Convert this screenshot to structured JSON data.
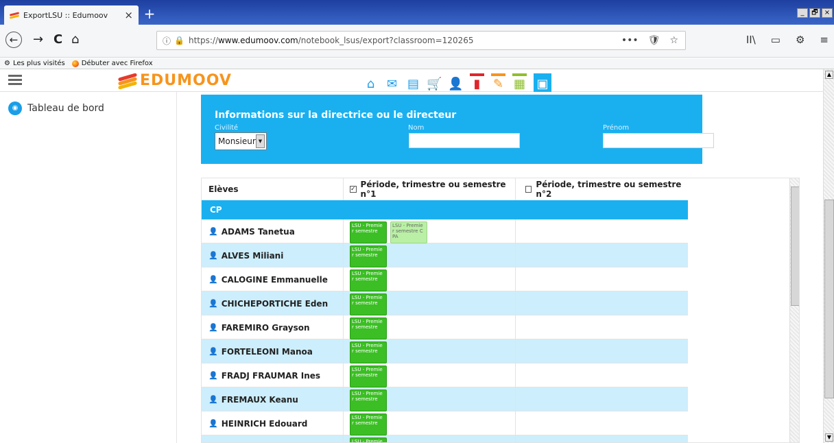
{
  "tab": {
    "title": "ExportLSU :: Edumoov",
    "close": "×",
    "new_tab": "+"
  },
  "window_controls": [
    "_",
    "🗗",
    "×"
  ],
  "navbar": {
    "back": "←",
    "forward": "→",
    "reload": "C",
    "home": "⌂",
    "url_domain": "www.edumoov.com",
    "url_prefix": "https://",
    "url_path": "/notebook_lsus/export?classroom=120265",
    "tools": [
      "•••",
      "🛡",
      "☆"
    ],
    "right": [
      "II\\",
      "▭",
      "⚙",
      "≡"
    ]
  },
  "bookmarks": [
    "Les plus visités",
    "Débuter avec Firefox"
  ],
  "brand": {
    "name": "EDUMOOV",
    "colors": [
      "#e53b2c",
      "#f7941d",
      "#f4b400"
    ]
  },
  "sidebar": {
    "items": [
      {
        "label": "Tableau de bord"
      }
    ]
  },
  "info": {
    "title": "Informations sur la directrice ou le directeur",
    "civilite_label": "Civilité",
    "civilite_value": "Monsieur",
    "nom_label": "Nom",
    "nom_value": "",
    "prenom_label": "Prénom",
    "prenom_value": ""
  },
  "table": {
    "headers": [
      "Elèves",
      "Période, trimestre ou semestre n°1",
      "Période, trimestre ou semestre n°2"
    ],
    "period1_checked": true,
    "period2_checked": false,
    "group": "CP",
    "badge_label": "LSU - Premier semestre",
    "badge_label_cpa": "LSU - Premier semestre CPA",
    "students": [
      {
        "name": "ADAMS Tanetua",
        "badges": [
          "LSU - Premie r semestre",
          "LSU - Premie r semestre C PA"
        ]
      },
      {
        "name": "ALVES Miliani",
        "badges": [
          "LSU - Premie r semestre"
        ]
      },
      {
        "name": "CALOGINE Emmanuelle",
        "badges": [
          "LSU - Premie r semestre"
        ]
      },
      {
        "name": "CHICHEPORTICHE Eden",
        "badges": [
          "LSU - Premie r semestre"
        ]
      },
      {
        "name": "FAREMIRO Grayson",
        "badges": [
          "LSU - Premie r semestre"
        ]
      },
      {
        "name": "FORTELEONI Manoa",
        "badges": [
          "LSU - Premie r semestre"
        ]
      },
      {
        "name": "FRADJ FRAUMAR Ines",
        "badges": [
          "LSU - Premie r semestre"
        ]
      },
      {
        "name": "FREMAUX Keanu",
        "badges": [
          "LSU - Premie r semestre"
        ]
      },
      {
        "name": "HEINRICH Edouard",
        "badges": [
          "LSU - Premie r semestre"
        ]
      },
      {
        "name": "",
        "badges": [
          "LSU - Premie"
        ]
      }
    ]
  }
}
